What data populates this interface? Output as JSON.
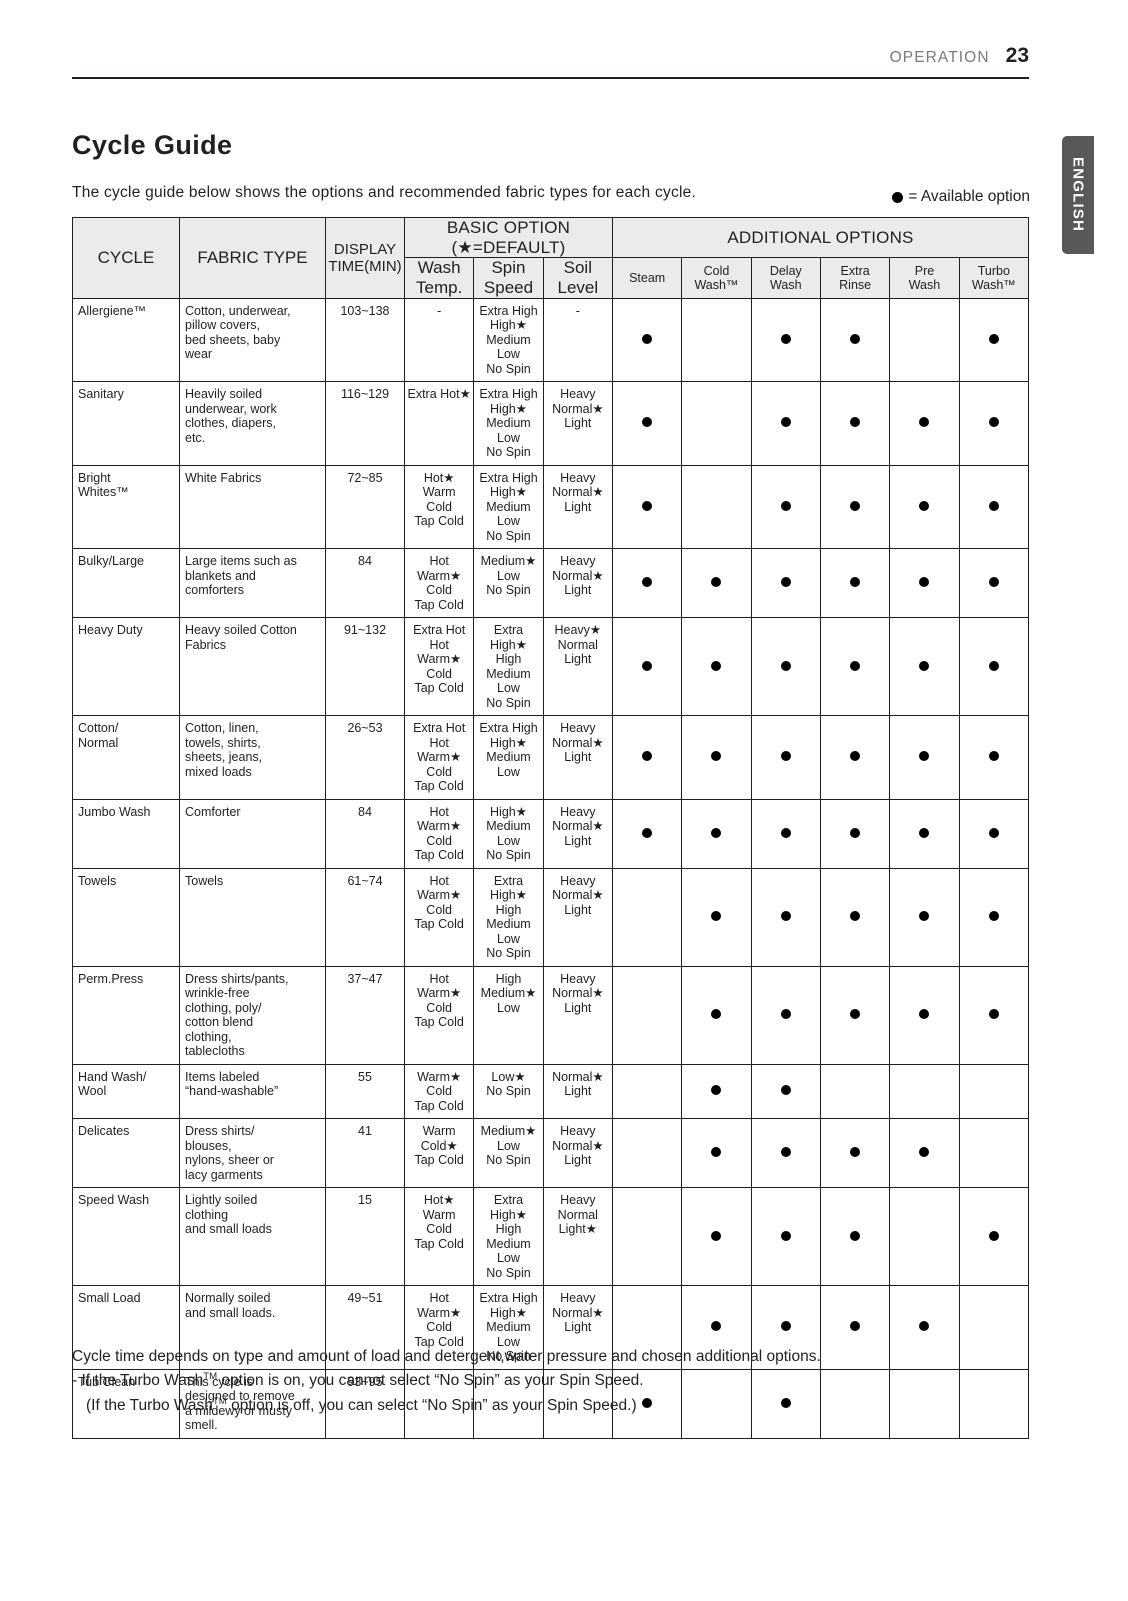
{
  "header": {
    "section": "OPERATION",
    "page_number": "23",
    "language_tab": "ENGLISH"
  },
  "title": "Cycle Guide",
  "intro": "The cycle guide below shows the options and recommended fabric types for each cycle.",
  "legend": "= Available option",
  "table": {
    "group_headers": {
      "basic": "BASIC OPTION (★=DEFAULT)",
      "additional": "ADDITIONAL OPTIONS"
    },
    "columns": {
      "cycle": "CYCLE",
      "fabric_type": "FABRIC TYPE",
      "display_time": "DISPLAY\nTIME(MIN)",
      "wash_temp": "Wash\nTemp.",
      "spin_speed": "Spin\nSpeed",
      "soil_level": "Soil\nLevel",
      "steam": "Steam",
      "cold_wash": "Cold\nWash™",
      "delay_wash": "Delay\nWash",
      "extra_rinse": "Extra\nRinse",
      "pre_wash": "Pre\nWash",
      "turbo_wash": "Turbo\nWash™"
    },
    "rows": [
      {
        "cycle": "Allergiene™",
        "fabric": "Cotton, underwear,\npillow covers,\nbed sheets, baby\nwear",
        "time": "103~138",
        "wash": "-",
        "spin": "Extra High\nHigh★\nMedium\nLow\nNo Spin",
        "soil": "-",
        "options": [
          true,
          false,
          true,
          true,
          false,
          true
        ]
      },
      {
        "cycle": "Sanitary",
        "fabric": "Heavily soiled\nunderwear, work\nclothes, diapers,\netc.",
        "time": "116~129",
        "wash": "Extra Hot★",
        "spin": "Extra High\nHigh★\nMedium\nLow\nNo Spin",
        "soil": "Heavy\nNormal★\nLight",
        "options": [
          true,
          false,
          true,
          true,
          true,
          true
        ]
      },
      {
        "cycle": "Bright\nWhites™",
        "fabric": "White Fabrics",
        "time": "72~85",
        "wash": "Hot★\nWarm\nCold\nTap Cold",
        "spin": "Extra High\nHigh★\nMedium\nLow\nNo Spin",
        "soil": "Heavy\nNormal★\nLight",
        "options": [
          true,
          false,
          true,
          true,
          true,
          true
        ]
      },
      {
        "cycle": "Bulky/Large",
        "fabric": "Large items such as\nblankets and\ncomforters",
        "time": "84",
        "wash": "Hot\nWarm★\nCold\nTap Cold",
        "spin": "Medium★\nLow\nNo Spin",
        "soil": "Heavy\nNormal★\nLight",
        "options": [
          true,
          true,
          true,
          true,
          true,
          true
        ]
      },
      {
        "cycle": "Heavy Duty",
        "fabric": "Heavy soiled Cotton\nFabrics",
        "time": "91~132",
        "wash": "Extra Hot\nHot\nWarm★\nCold\nTap Cold",
        "spin": "Extra High★\nHigh\nMedium\nLow\nNo Spin",
        "soil": "Heavy★\nNormal\nLight",
        "options": [
          true,
          true,
          true,
          true,
          true,
          true
        ]
      },
      {
        "cycle": "Cotton/\nNormal",
        "fabric": "Cotton, linen,\ntowels, shirts,\nsheets, jeans,\nmixed loads",
        "time": "26~53",
        "wash": "Extra Hot\nHot\nWarm★\nCold\nTap Cold",
        "spin": "Extra High\nHigh★\nMedium\nLow",
        "soil": "Heavy\nNormal★\nLight",
        "options": [
          true,
          true,
          true,
          true,
          true,
          true
        ]
      },
      {
        "cycle": "Jumbo Wash",
        "fabric": "Comforter",
        "time": "84",
        "wash": "Hot\nWarm★\nCold\nTap Cold",
        "spin": "High★\nMedium\nLow\nNo Spin",
        "soil": "Heavy\nNormal★\nLight",
        "options": [
          true,
          true,
          true,
          true,
          true,
          true
        ]
      },
      {
        "cycle": "Towels",
        "fabric": "Towels",
        "time": "61~74",
        "wash": "Hot\nWarm★\nCold\nTap Cold",
        "spin": "Extra High★\nHigh\nMedium\nLow\nNo Spin",
        "soil": "Heavy\nNormal★\nLight",
        "options": [
          false,
          true,
          true,
          true,
          true,
          true
        ]
      },
      {
        "cycle": "Perm.Press",
        "fabric": "Dress shirts/pants,\nwrinkle-free\nclothing, poly/\ncotton blend\nclothing,\ntablecloths",
        "time": "37~47",
        "wash": "Hot\nWarm★\nCold\nTap Cold",
        "spin": "High\nMedium★\nLow",
        "soil": "Heavy\nNormal★\nLight",
        "options": [
          false,
          true,
          true,
          true,
          true,
          true
        ]
      },
      {
        "cycle": "Hand Wash/\nWool",
        "fabric": "Items labeled\n“hand-washable”",
        "time": "55",
        "wash": "Warm★\nCold\nTap Cold",
        "spin": "Low★\nNo Spin",
        "soil": "Normal★\nLight",
        "options": [
          false,
          true,
          true,
          false,
          false,
          false
        ]
      },
      {
        "cycle": "Delicates",
        "fabric": "Dress shirts/\nblouses,\nnylons, sheer or\nlacy garments",
        "time": "41",
        "wash": "Warm\nCold★\nTap Cold",
        "spin": "Medium★\nLow\nNo Spin",
        "soil": "Heavy\nNormal★\nLight",
        "options": [
          false,
          true,
          true,
          true,
          true,
          false
        ]
      },
      {
        "cycle": "Speed Wash",
        "fabric": "Lightly soiled\nclothing\nand small loads",
        "time": "15",
        "wash": "Hot★\nWarm\nCold\nTap Cold",
        "spin": "Extra High★\nHigh\nMedium\nLow\nNo Spin",
        "soil": "Heavy\nNormal\nLight★",
        "options": [
          false,
          true,
          true,
          true,
          false,
          true
        ]
      },
      {
        "cycle": "Small Load",
        "fabric": "Normally soiled\nand small loads.",
        "time": "49~51",
        "wash": "Hot\nWarm★\nCold\nTap Cold",
        "spin": "Extra High\nHigh★\nMedium\nLow\nNo Spin",
        "soil": "Heavy\nNormal★\nLight",
        "options": [
          false,
          true,
          true,
          true,
          true,
          false
        ]
      },
      {
        "cycle": "Tub Clean",
        "fabric": "This cycle is\ndesigned to remove\na mildewy or musty\nsmell.",
        "time": "93~95",
        "wash": "",
        "spin": "",
        "soil": "",
        "options": [
          true,
          false,
          true,
          false,
          false,
          false
        ]
      }
    ]
  },
  "notes": {
    "line1": "Cycle time depends on type and amount of load and detergent,water pressure and chosen additional options.",
    "line2_pre": "- If the Turbo Wash",
    "line2_post": " option is on, you cannot select “No Spin” as your Spin Speed.",
    "line3_pre": "(If the Turbo Wash",
    "line3_post": " option is off, you can select “No Spin” as your Spin Speed.)",
    "tm": "TM"
  }
}
